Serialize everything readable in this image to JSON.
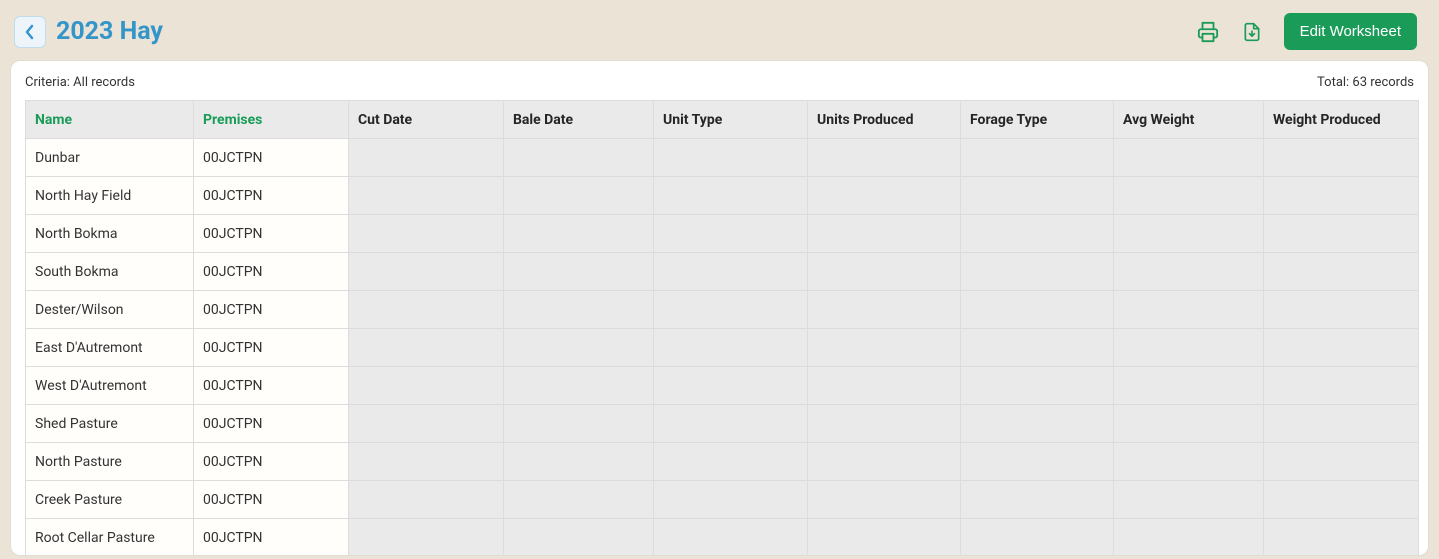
{
  "header": {
    "title": "2023 Hay",
    "edit_label": "Edit Worksheet"
  },
  "panel": {
    "criteria_label": "Criteria: All records",
    "total_label": "Total: 63 records"
  },
  "table": {
    "columns": [
      {
        "label": "Name",
        "sorted": true
      },
      {
        "label": "Premises",
        "sorted": true
      },
      {
        "label": "Cut Date",
        "sorted": false
      },
      {
        "label": "Bale Date",
        "sorted": false
      },
      {
        "label": "Unit Type",
        "sorted": false
      },
      {
        "label": "Units Produced",
        "sorted": false
      },
      {
        "label": "Forage Type",
        "sorted": false
      },
      {
        "label": "Avg Weight",
        "sorted": false
      },
      {
        "label": "Weight Produced",
        "sorted": false
      }
    ],
    "rows": [
      {
        "name": "Dunbar",
        "premises": "00JCTPN",
        "cut_date": "",
        "bale_date": "",
        "unit_type": "",
        "units_produced": "",
        "forage_type": "",
        "avg_weight": "",
        "weight_produced": ""
      },
      {
        "name": "North Hay Field",
        "premises": "00JCTPN",
        "cut_date": "",
        "bale_date": "",
        "unit_type": "",
        "units_produced": "",
        "forage_type": "",
        "avg_weight": "",
        "weight_produced": ""
      },
      {
        "name": "North Bokma",
        "premises": "00JCTPN",
        "cut_date": "",
        "bale_date": "",
        "unit_type": "",
        "units_produced": "",
        "forage_type": "",
        "avg_weight": "",
        "weight_produced": ""
      },
      {
        "name": "South Bokma",
        "premises": "00JCTPN",
        "cut_date": "",
        "bale_date": "",
        "unit_type": "",
        "units_produced": "",
        "forage_type": "",
        "avg_weight": "",
        "weight_produced": ""
      },
      {
        "name": "Dester/Wilson",
        "premises": "00JCTPN",
        "cut_date": "",
        "bale_date": "",
        "unit_type": "",
        "units_produced": "",
        "forage_type": "",
        "avg_weight": "",
        "weight_produced": ""
      },
      {
        "name": "East D'Autremont",
        "premises": "00JCTPN",
        "cut_date": "",
        "bale_date": "",
        "unit_type": "",
        "units_produced": "",
        "forage_type": "",
        "avg_weight": "",
        "weight_produced": ""
      },
      {
        "name": "West D'Autremont",
        "premises": "00JCTPN",
        "cut_date": "",
        "bale_date": "",
        "unit_type": "",
        "units_produced": "",
        "forage_type": "",
        "avg_weight": "",
        "weight_produced": ""
      },
      {
        "name": "Shed Pasture",
        "premises": "00JCTPN",
        "cut_date": "",
        "bale_date": "",
        "unit_type": "",
        "units_produced": "",
        "forage_type": "",
        "avg_weight": "",
        "weight_produced": ""
      },
      {
        "name": "North Pasture",
        "premises": "00JCTPN",
        "cut_date": "",
        "bale_date": "",
        "unit_type": "",
        "units_produced": "",
        "forage_type": "",
        "avg_weight": "",
        "weight_produced": ""
      },
      {
        "name": "Creek Pasture",
        "premises": "00JCTPN",
        "cut_date": "",
        "bale_date": "",
        "unit_type": "",
        "units_produced": "",
        "forage_type": "",
        "avg_weight": "",
        "weight_produced": ""
      },
      {
        "name": "Root Cellar Pasture",
        "premises": "00JCTPN",
        "cut_date": "",
        "bale_date": "",
        "unit_type": "",
        "units_produced": "",
        "forage_type": "",
        "avg_weight": "",
        "weight_produced": ""
      }
    ]
  }
}
